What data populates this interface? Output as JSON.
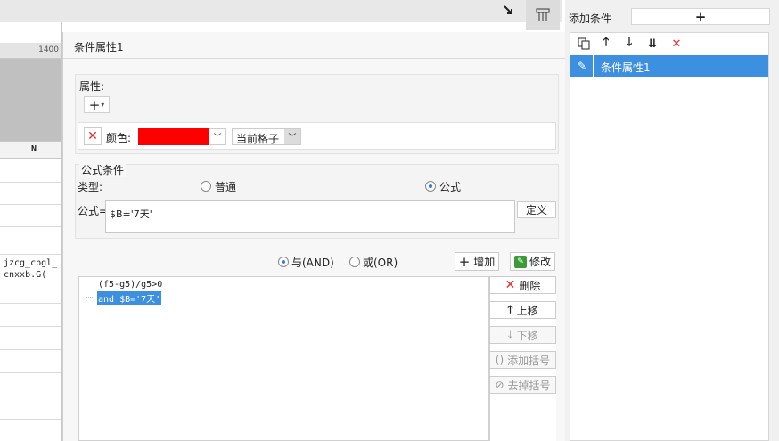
{
  "top": {
    "icon_a": "filter-down-icon",
    "icon_b": "layout-icon"
  },
  "sheet": {
    "ruler_label": "1400",
    "column_header": "N",
    "cell_line1": "jzcg_cpgl_",
    "cell_line2": "cnxxb.G("
  },
  "dialog": {
    "title": "条件属性1",
    "attributes": {
      "label": "属性:",
      "add_button": "+",
      "color_label": "颜色:",
      "color_value": "#ff0000",
      "scope": "当前格子"
    },
    "formula_condition": {
      "group_label": "公式条件",
      "type_label": "类型:",
      "option_normal": "普通",
      "option_formula": "公式",
      "selected": "公式",
      "formula_prefix": "公式=",
      "formula_value": "$B='7天'",
      "define_button": "定义"
    },
    "join": {
      "and_label": "与(AND)",
      "or_label": "或(OR)",
      "selected": "与(AND)"
    },
    "buttons": {
      "add": "增加",
      "modify": "修改",
      "delete": "删除",
      "up": "上移",
      "down": "下移",
      "add_bracket": "添加括号",
      "remove_bracket": "去掉括号"
    },
    "conditions": [
      "(f5-g5)/g5>0",
      "and $B='7天'"
    ]
  },
  "right_panel": {
    "title": "添加条件",
    "add_button": "+",
    "items": [
      {
        "label": "条件属性1",
        "selected": true
      }
    ]
  },
  "colors": {
    "accent": "#3d8fe0",
    "delete_red": "#e52b2b",
    "swatch": "#ff0000"
  }
}
